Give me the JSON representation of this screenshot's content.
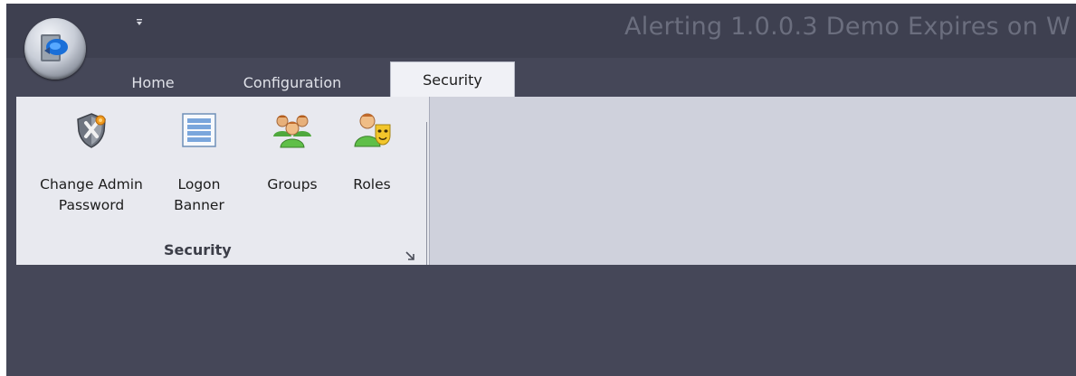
{
  "window": {
    "title": "Alerting 1.0.0.3 Demo Expires on W",
    "qat_glyph": "⩿"
  },
  "tabs": [
    {
      "label": "Home"
    },
    {
      "label": "Configuration"
    },
    {
      "label": "Security",
      "active": true
    }
  ],
  "ribbon": {
    "group": {
      "title": "Security",
      "buttons": [
        {
          "label": "Change Admin\nPassword",
          "icon": "shield-key-icon"
        },
        {
          "label": "Logon\nBanner",
          "icon": "banner-icon"
        },
        {
          "label": "Groups",
          "icon": "users-group-icon"
        },
        {
          "label": "Roles",
          "icon": "user-role-mask-icon"
        }
      ],
      "launcher_icon": "dialog-launcher-icon"
    }
  },
  "colors": {
    "frame": "#454758",
    "ribbon": "#cfd1dc",
    "group_panel": "#e8e9ef",
    "active_tab": "#f0f1f6",
    "title_text": "#6b6e7e"
  }
}
